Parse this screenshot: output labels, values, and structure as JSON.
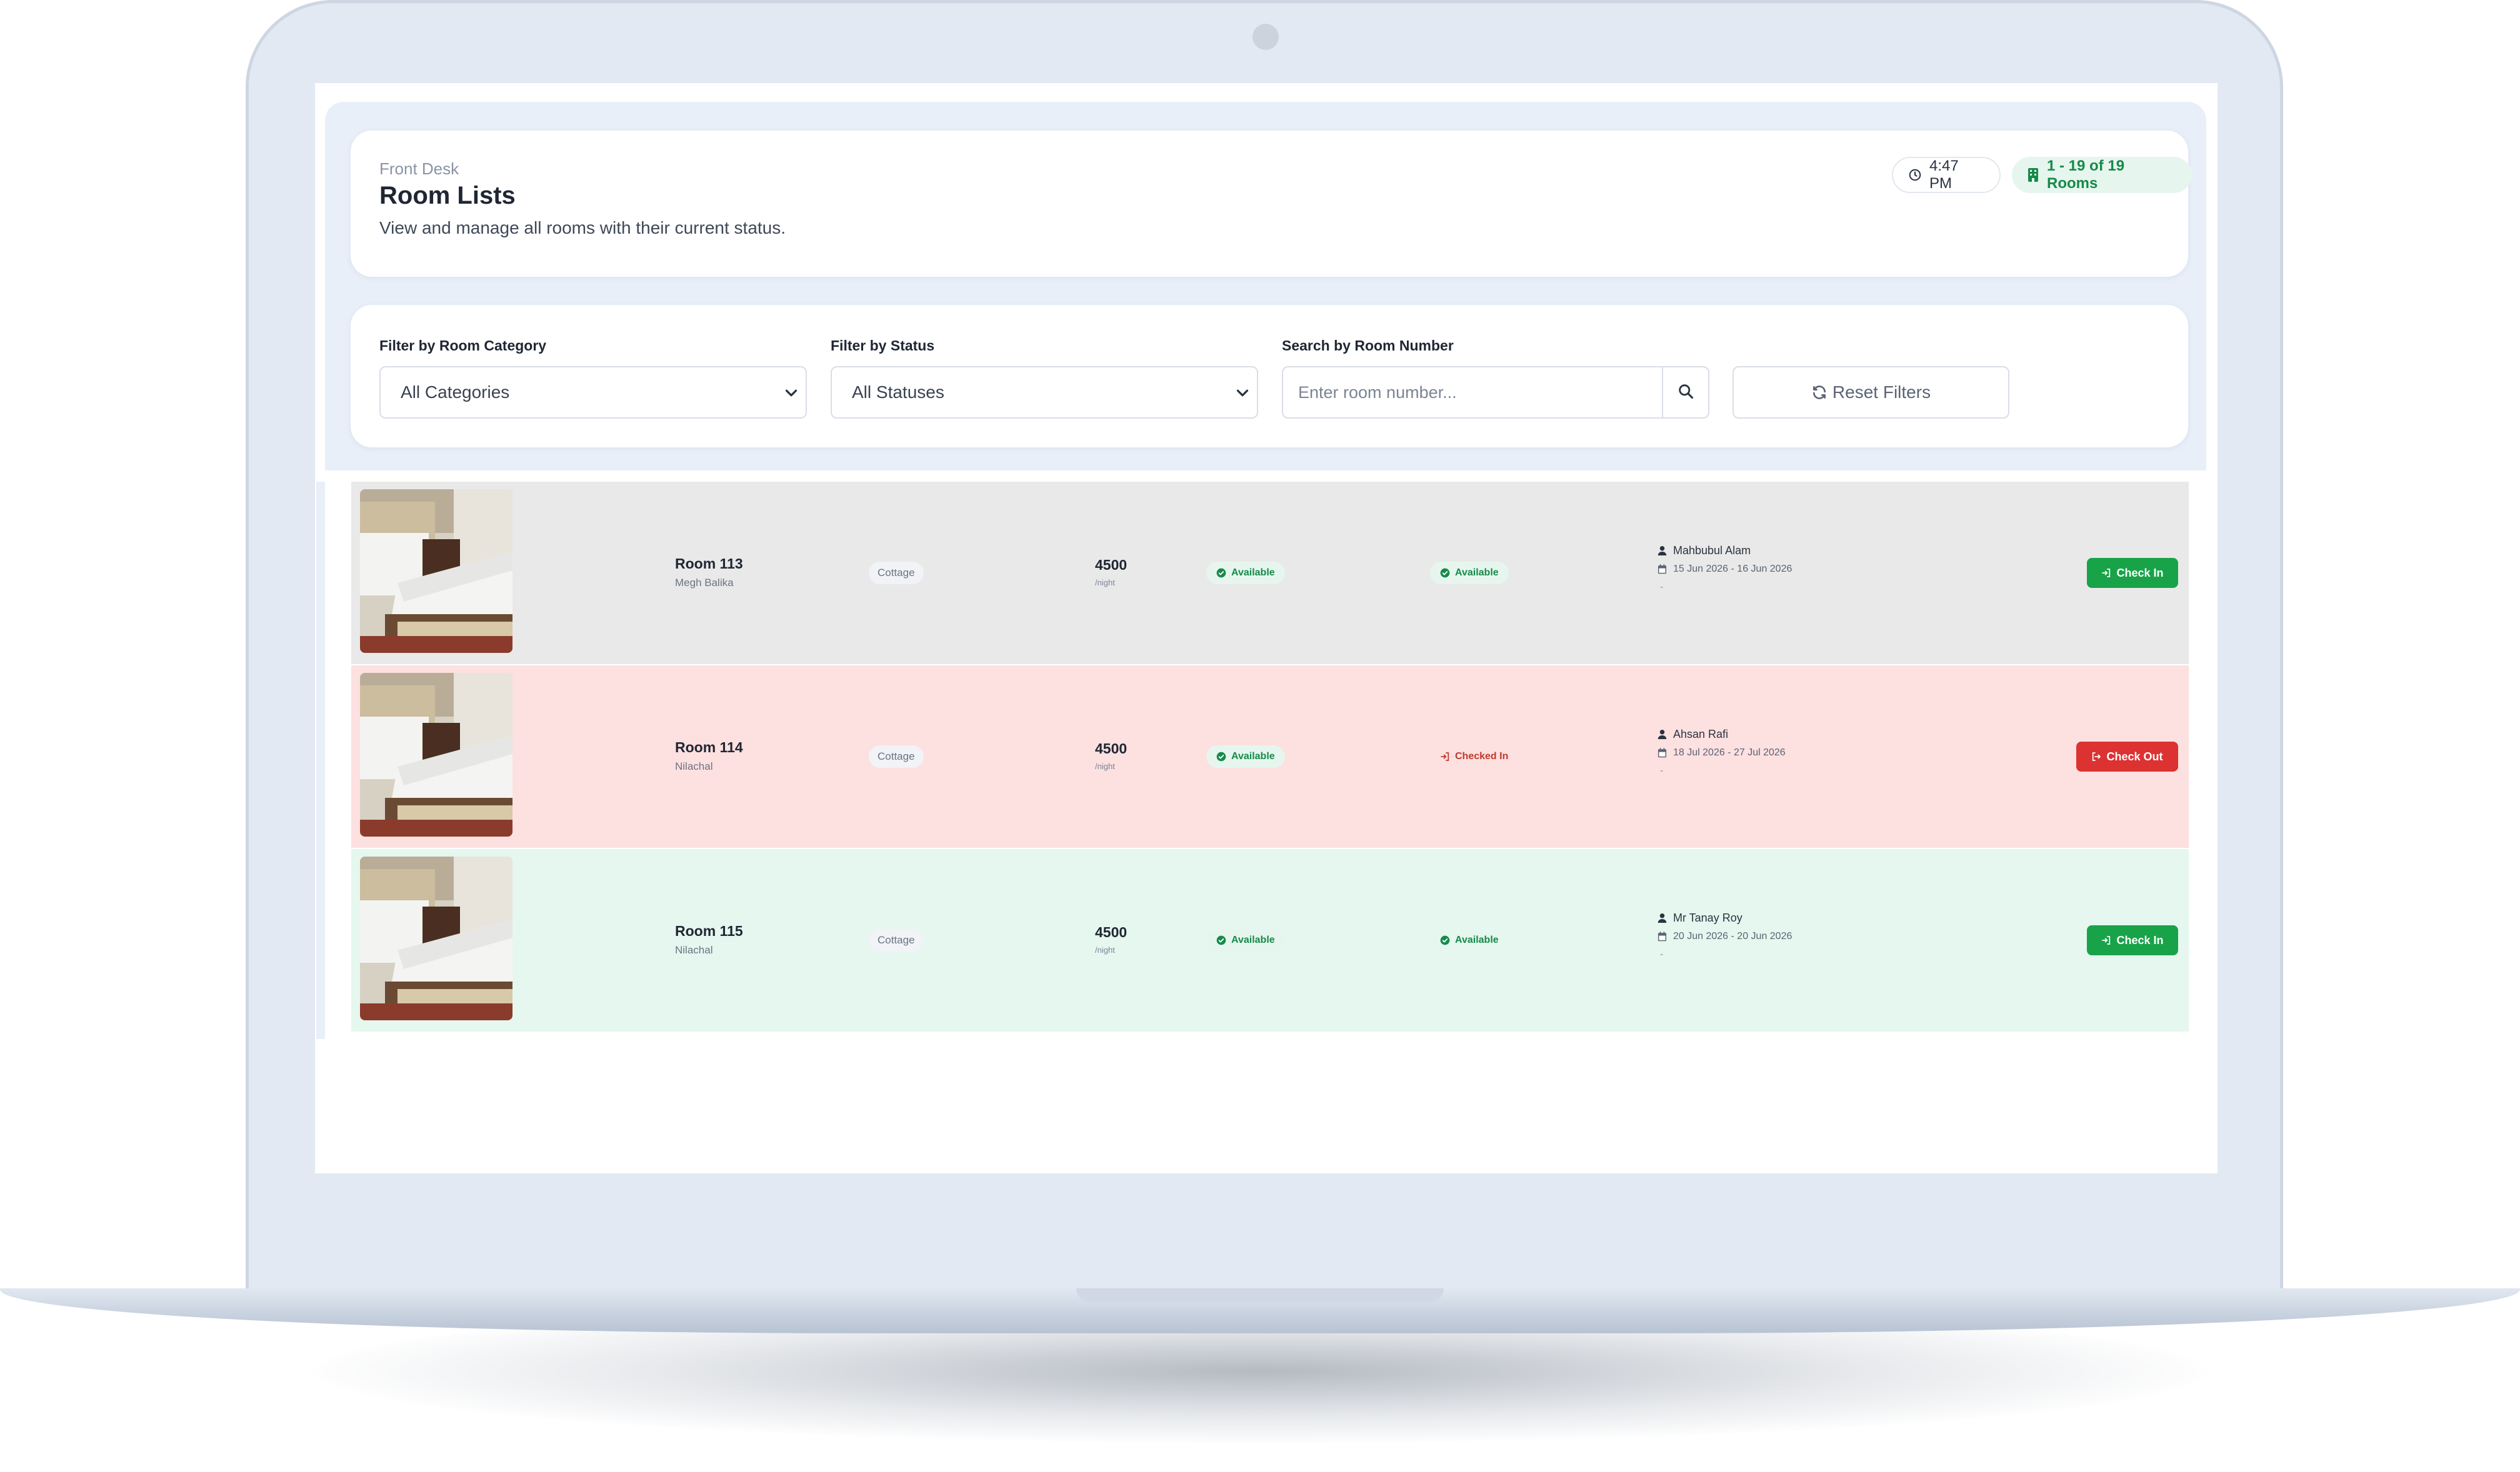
{
  "header": {
    "breadcrumb": "Front Desk",
    "title": "Room Lists",
    "subtitle": "View and manage all rooms with their current status.",
    "time": "4:47 PM",
    "rooms_count": "1 - 19 of 19 Rooms"
  },
  "filters": {
    "category_label": "Filter by Room Category",
    "category_value": "All Categories",
    "status_label": "Filter by Status",
    "status_value": "All Statuses",
    "search_label": "Search by Room Number",
    "search_placeholder": "Enter room number...",
    "reset_label": "Reset Filters"
  },
  "rooms": [
    {
      "name": "Room 113",
      "location": "Megh Balika",
      "category": "Cottage",
      "price": "4500",
      "per": "/night",
      "status1": "Available",
      "status2": "Available",
      "guest": "Mahbubul Alam",
      "dates": "15 Jun 2026 - 16 Jun 2026",
      "extra": "-",
      "action": "Check In",
      "row_color": "#e9e9e9"
    },
    {
      "name": "Room 114",
      "location": "Nilachal",
      "category": "Cottage",
      "price": "4500",
      "per": "/night",
      "status1": "Available",
      "status2": "Checked In",
      "guest": "Ahsan Rafi",
      "dates": "18 Jul 2026 - 27 Jul 2026",
      "extra": "-",
      "action": "Check Out",
      "row_color": "#fde0e0"
    },
    {
      "name": "Room 115",
      "location": "Nilachal",
      "category": "Cottage",
      "price": "4500",
      "per": "/night",
      "status1": "Available",
      "status2": "Available",
      "guest": "Mr Tanay Roy",
      "dates": "20 Jun 2026 - 20 Jun 2026",
      "extra": "-",
      "action": "Check In",
      "row_color": "#e5f7ee"
    }
  ],
  "colors": {
    "accent_green": "#18a349",
    "accent_red": "#dc3232",
    "available_text": "#168a4a",
    "checked_in_text": "#c0392b"
  }
}
